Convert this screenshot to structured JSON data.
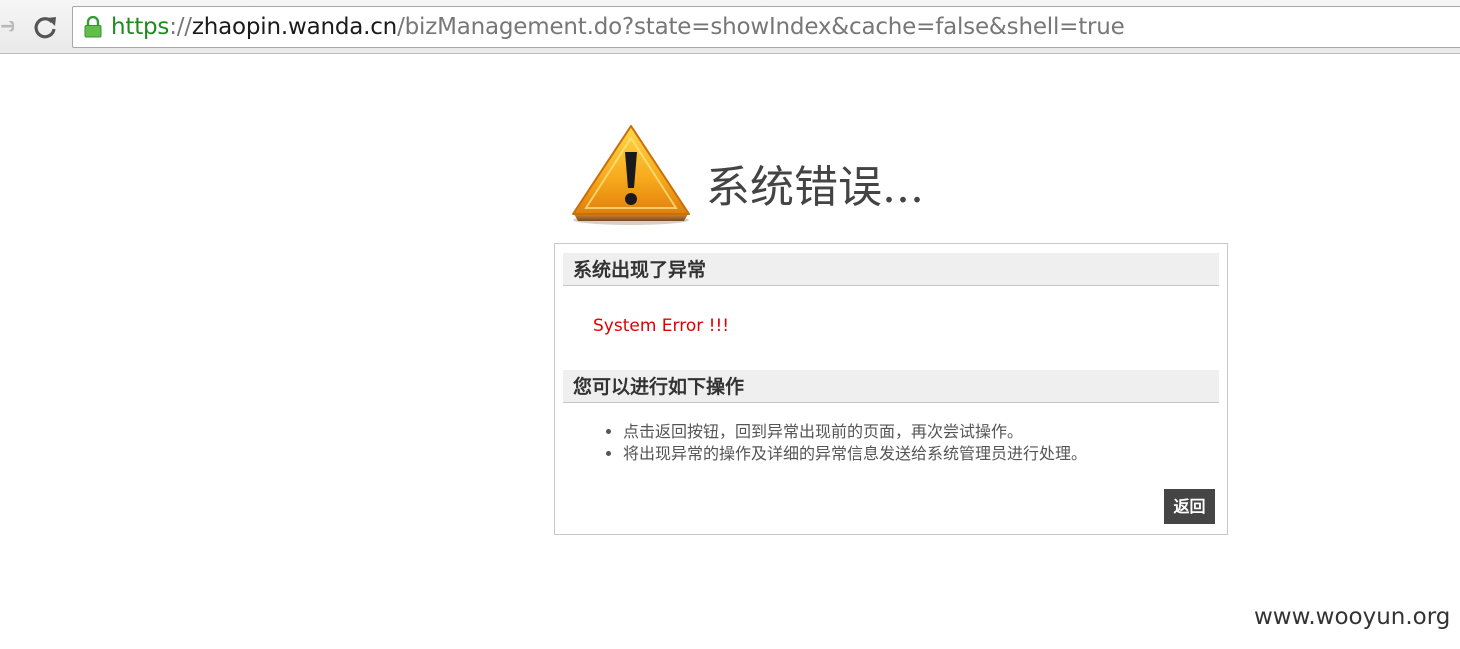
{
  "browser": {
    "url": {
      "scheme": "https",
      "separator": "://",
      "host": "zhaopin.wanda.cn",
      "path": "/bizManagement.do?state=showIndex&cache=false&shell=true"
    },
    "icons": {
      "forward": "forward-arrow-icon",
      "reload": "reload-icon",
      "lock": "padlock-icon"
    }
  },
  "page": {
    "title": "系统错误...",
    "warning_icon": "warning-triangle-icon",
    "section1_heading": "系统出现了异常",
    "error_message": "System Error !!!",
    "section2_heading": "您可以进行如下操作",
    "actions": [
      "点击返回按钮，回到异常出现前的页面，再次尝试操作。",
      "将出现异常的操作及详细的异常信息发送给系统管理员进行处理。"
    ],
    "back_button": "返回"
  },
  "watermark": "www.wooyun.org",
  "colors": {
    "scheme_green": "#1e8b1e",
    "error_red": "#e00000",
    "button_bg": "#454545"
  }
}
